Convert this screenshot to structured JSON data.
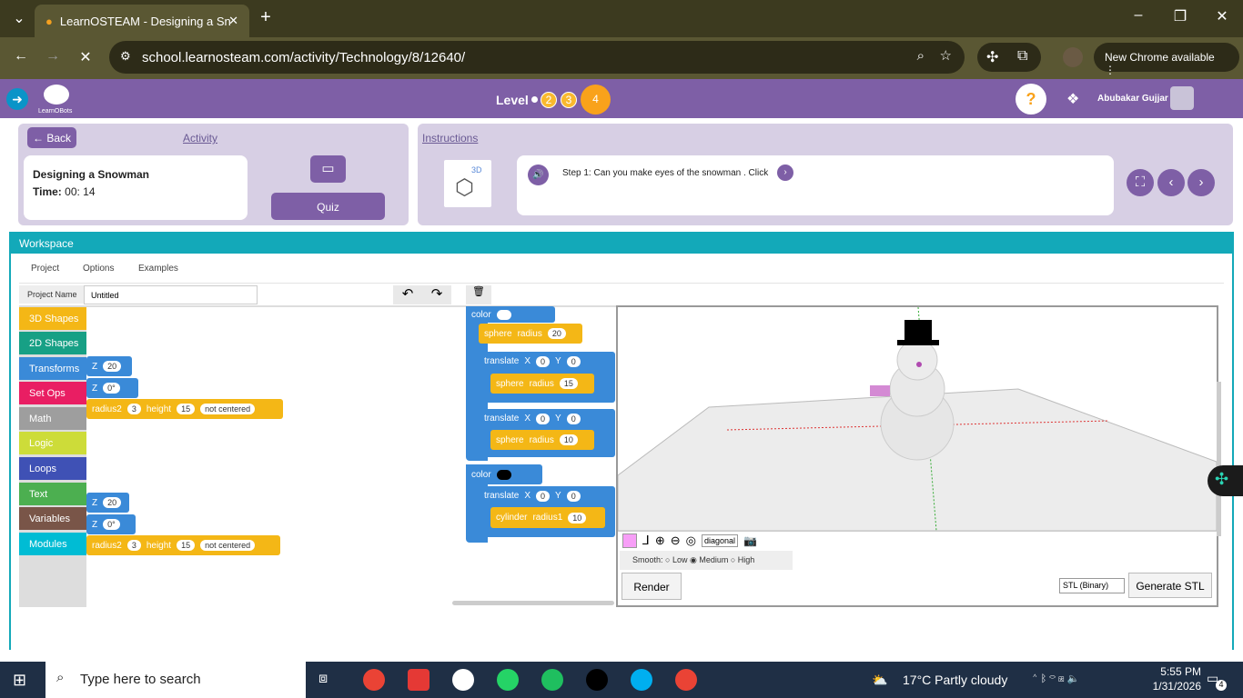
{
  "browser": {
    "tab_title": "LearnOSTEAM - Designing a Sn",
    "url": "school.learnosteam.com/activity/Technology/8/12640/",
    "new_chrome": "New Chrome available"
  },
  "app": {
    "logo_text": "LearnOBots",
    "level_label": "Level",
    "levels": [
      "2",
      "3",
      "4"
    ],
    "help": "?",
    "user_name": "Abubakar Gujjar"
  },
  "activity": {
    "back": "Back",
    "tab_label": "Activity",
    "title": "Designing a Snowman",
    "time_label": "Time:",
    "time_value": "00: 14",
    "quiz": "Quiz"
  },
  "instructions": {
    "tab_label": "Instructions",
    "icon_label": "3D",
    "step": "Step 1: Can you make eyes of the snowman . Click"
  },
  "workspace": {
    "header": "Workspace",
    "menu": [
      "Project",
      "Options",
      "Examples"
    ],
    "project_name_label": "Project Name",
    "project_name_value": "Untitled",
    "categories": [
      {
        "label": "3D Shapes",
        "color": "#f4b716"
      },
      {
        "label": "2D Shapes",
        "color": "#17a085"
      },
      {
        "label": "Transforms",
        "color": "#3a8ad8"
      },
      {
        "label": "Set Ops",
        "color": "#e91e63"
      },
      {
        "label": "Math",
        "color": "#9e9e9e"
      },
      {
        "label": "Logic",
        "color": "#cddc39"
      },
      {
        "label": "Loops",
        "color": "#3f51b5"
      },
      {
        "label": "Text",
        "color": "#4caf50"
      },
      {
        "label": "Variables",
        "color": "#795548"
      },
      {
        "label": "Modules",
        "color": "#00bcd4"
      }
    ],
    "left_blocks": {
      "z1": "Z",
      "z1v": "20",
      "z2": "Z",
      "z2v": "0°",
      "r2": "radius2",
      "r2v": "3",
      "h": "height",
      "hv": "15",
      "nc": "not centered",
      "z3": "Z",
      "z3v": "20",
      "z4": "Z",
      "z4v": "0°",
      "r2b": "radius2",
      "r2bv": "3",
      "hb": "height",
      "hbv": "15",
      "ncb": "not centered"
    },
    "code": {
      "color": "color",
      "sphere": "sphere",
      "radius": "radius",
      "r1": "20",
      "translate": "translate",
      "x": "X",
      "y": "Y",
      "zero": "0",
      "r2": "15",
      "r3": "10",
      "cylinder": "cylinder",
      "radius1": "radius1",
      "cr": "10"
    },
    "viewer": {
      "view": "diagonal",
      "smooth_label": "Smooth:",
      "smooth_options": [
        "Low",
        "Medium",
        "High"
      ],
      "render": "Render",
      "format": "STL (Binary)",
      "generate": "Generate STL"
    }
  },
  "taskbar": {
    "search": "Type here to search",
    "weather": "17°C  Partly cloudy",
    "time": "5:55 PM",
    "date": "1/31/2026",
    "notif": "4"
  }
}
